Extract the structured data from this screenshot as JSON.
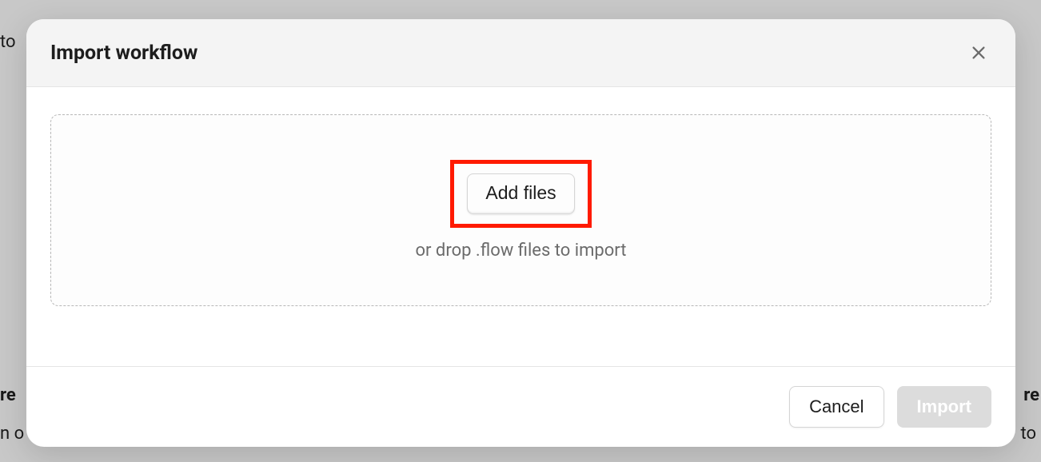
{
  "modal": {
    "title": "Import workflow",
    "dropzone": {
      "add_files_label": "Add files",
      "hint": "or drop .flow files to import"
    },
    "footer": {
      "cancel_label": "Cancel",
      "import_label": "Import"
    }
  },
  "backdrop": {
    "fragments": {
      "top_left": "to",
      "mid_left": "re",
      "low_left_1": "n o",
      "bottom_right_1": "re",
      "bottom_right_2": "to"
    }
  }
}
